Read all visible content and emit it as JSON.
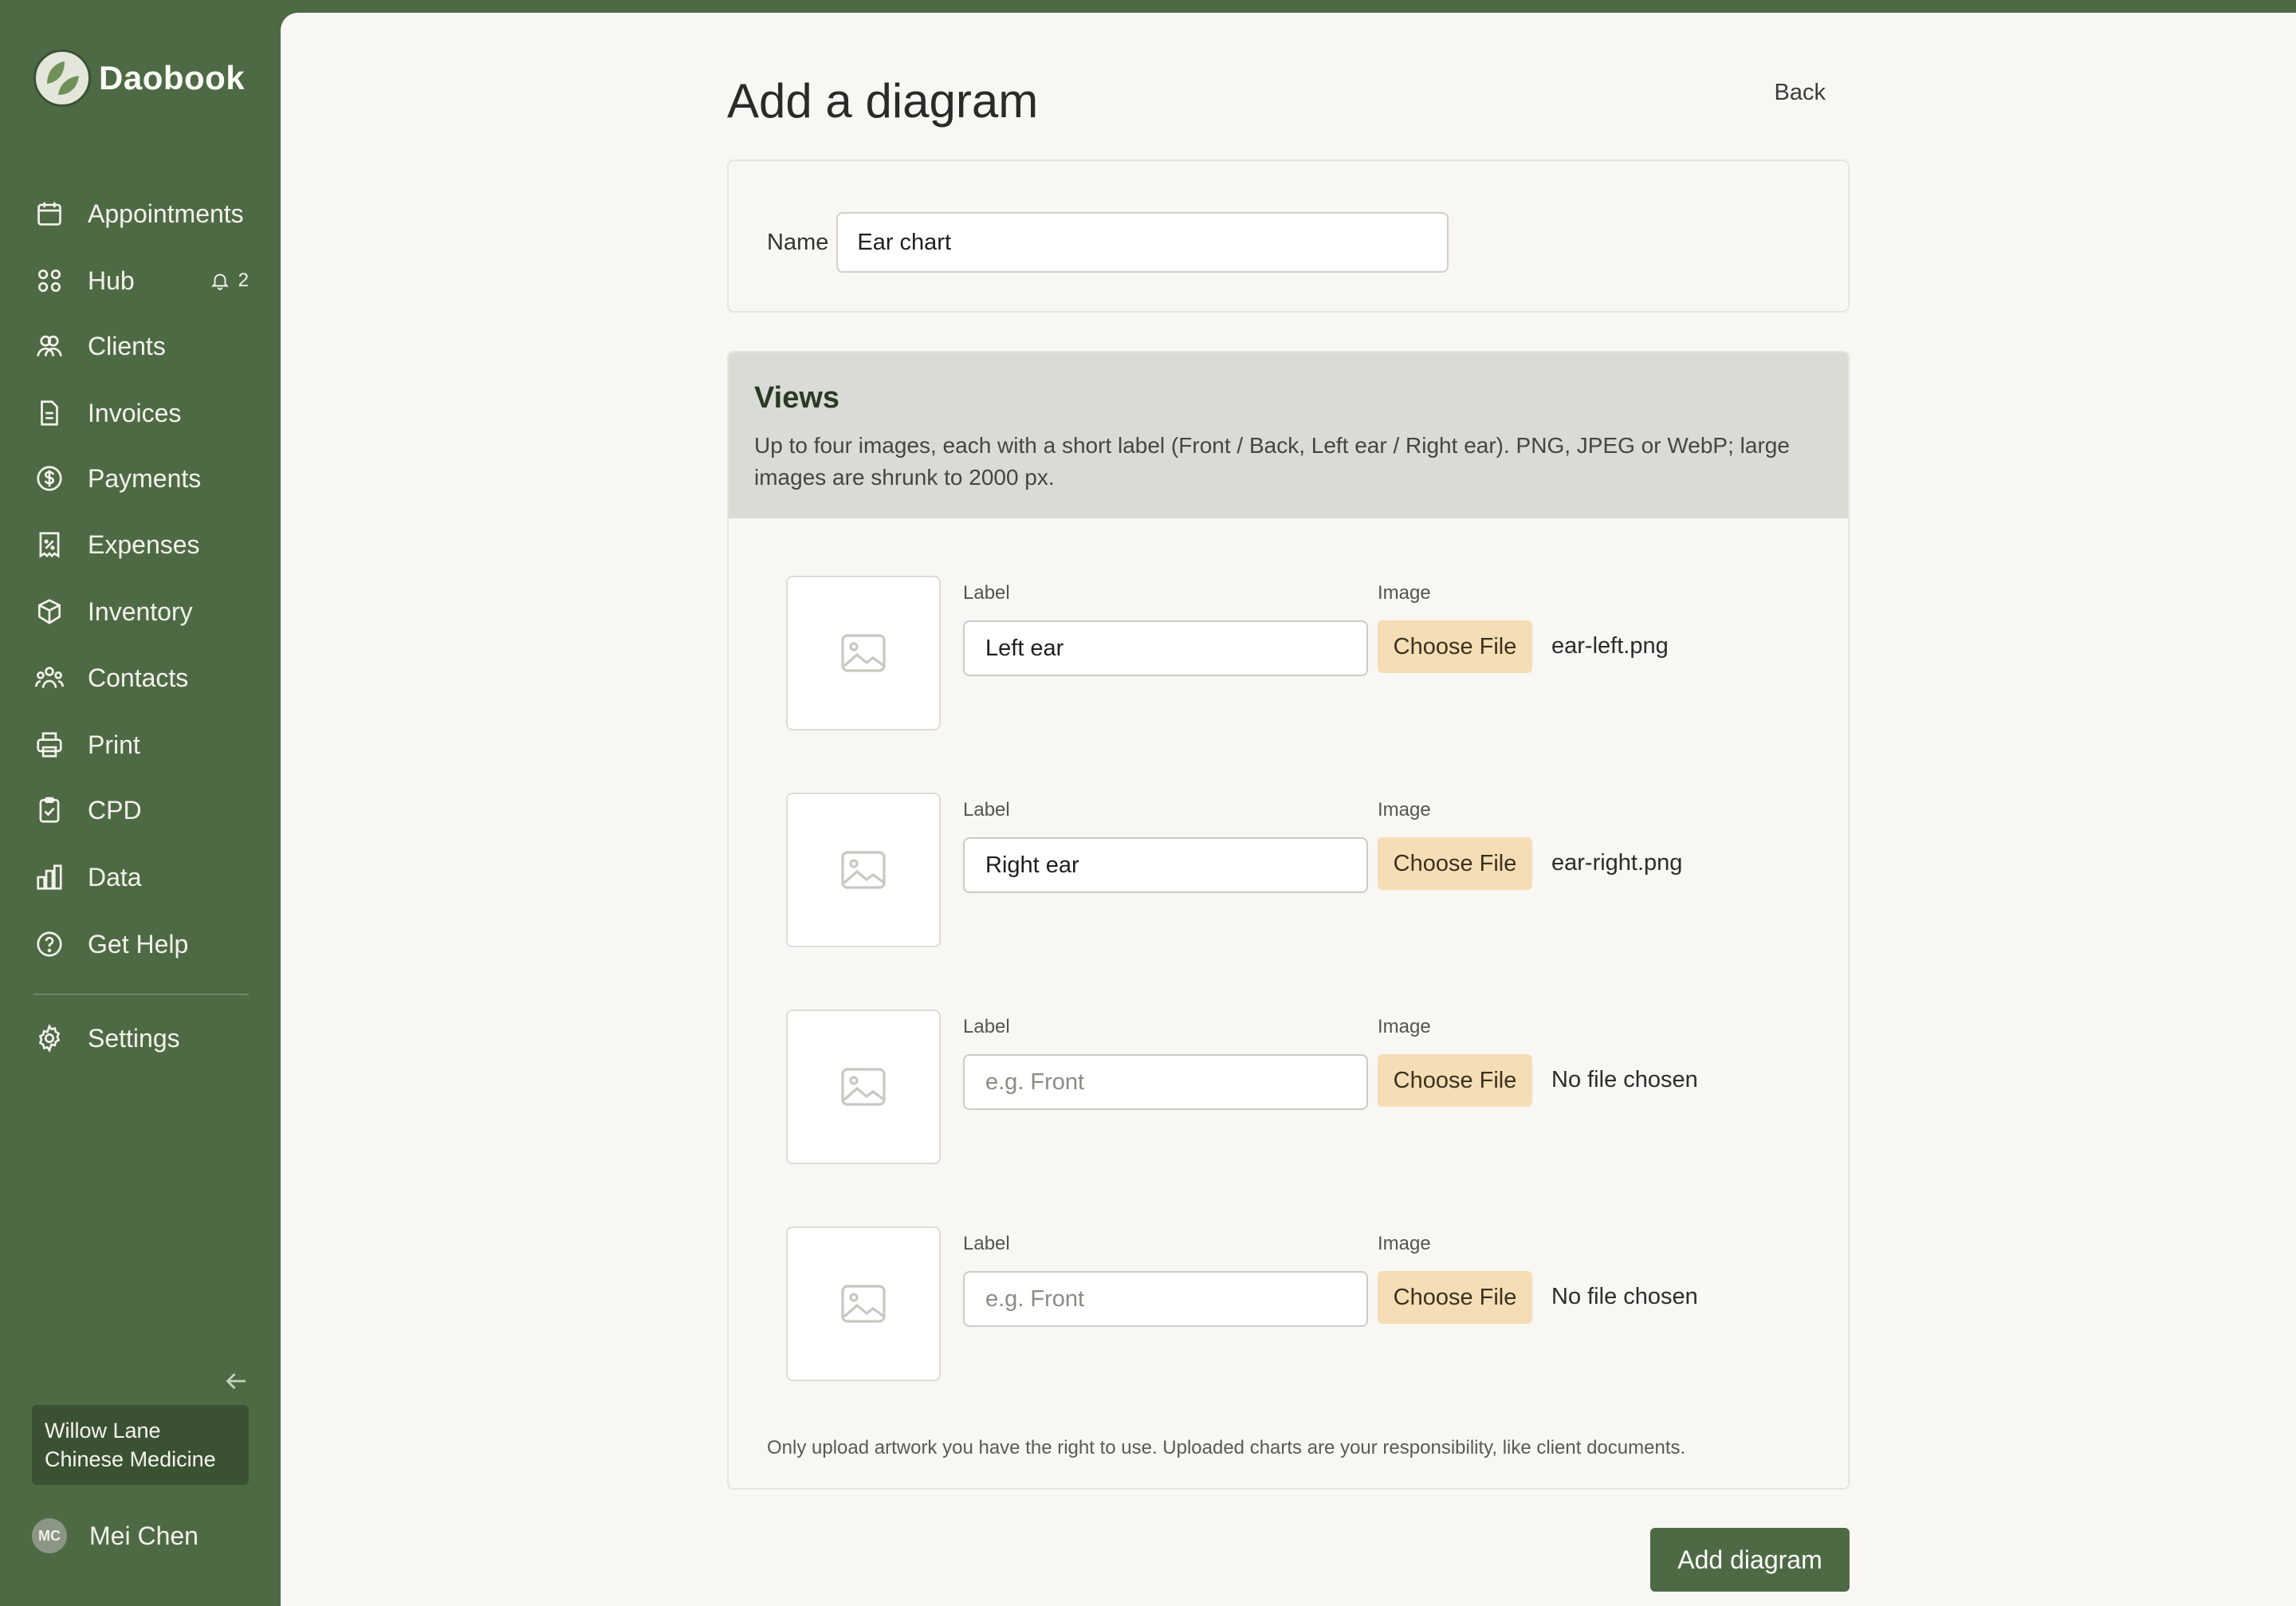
{
  "brand": {
    "name": "Daobook",
    "logo_icon": "leaf-logo-icon"
  },
  "nav": {
    "items": [
      {
        "label": "Appointments",
        "icon": "calendar-icon"
      },
      {
        "label": "Hub",
        "icon": "grid-icon",
        "badge": "2",
        "badge_icon": "bell-icon"
      },
      {
        "label": "Clients",
        "icon": "users-icon"
      },
      {
        "label": "Invoices",
        "icon": "document-icon"
      },
      {
        "label": "Payments",
        "icon": "dollar-circle-icon"
      },
      {
        "label": "Expenses",
        "icon": "receipt-icon"
      },
      {
        "label": "Inventory",
        "icon": "box-icon"
      },
      {
        "label": "Contacts",
        "icon": "group-icon"
      },
      {
        "label": "Print",
        "icon": "printer-icon"
      },
      {
        "label": "CPD",
        "icon": "clipboard-check-icon"
      },
      {
        "label": "Data",
        "icon": "bar-chart-icon"
      },
      {
        "label": "Get Help",
        "icon": "help-circle-icon"
      }
    ],
    "settings": {
      "label": "Settings",
      "icon": "gear-icon"
    }
  },
  "practice": {
    "line1": "Willow Lane",
    "line2": "Chinese Medicine"
  },
  "user": {
    "initials": "MC",
    "name": "Mei Chen"
  },
  "page": {
    "title": "Add a diagram",
    "back_label": "Back"
  },
  "name_field": {
    "label": "Name",
    "value": "Ear chart"
  },
  "views": {
    "title": "Views",
    "description": "Up to four images, each with a short label (Front / Back, Left ear / Right ear). PNG, JPEG or WebP; large images are shrunk to 2000 px.",
    "label_heading": "Label",
    "image_heading": "Image",
    "choose_label": "Choose File",
    "placeholder": "e.g. Front",
    "rows": [
      {
        "label_value": "Left ear",
        "file": "ear-left.png"
      },
      {
        "label_value": "Right ear",
        "file": "ear-right.png"
      },
      {
        "label_value": "",
        "file": "No file chosen"
      },
      {
        "label_value": "",
        "file": "No file chosen"
      }
    ],
    "footnote": "Only upload artwork you have the right to use. Uploaded charts are your responsibility, like client documents."
  },
  "submit_label": "Add diagram",
  "colors": {
    "sidebar": "#4e6a45",
    "accent_button": "#f5ddb5",
    "views_header": "#d9dcd4"
  }
}
